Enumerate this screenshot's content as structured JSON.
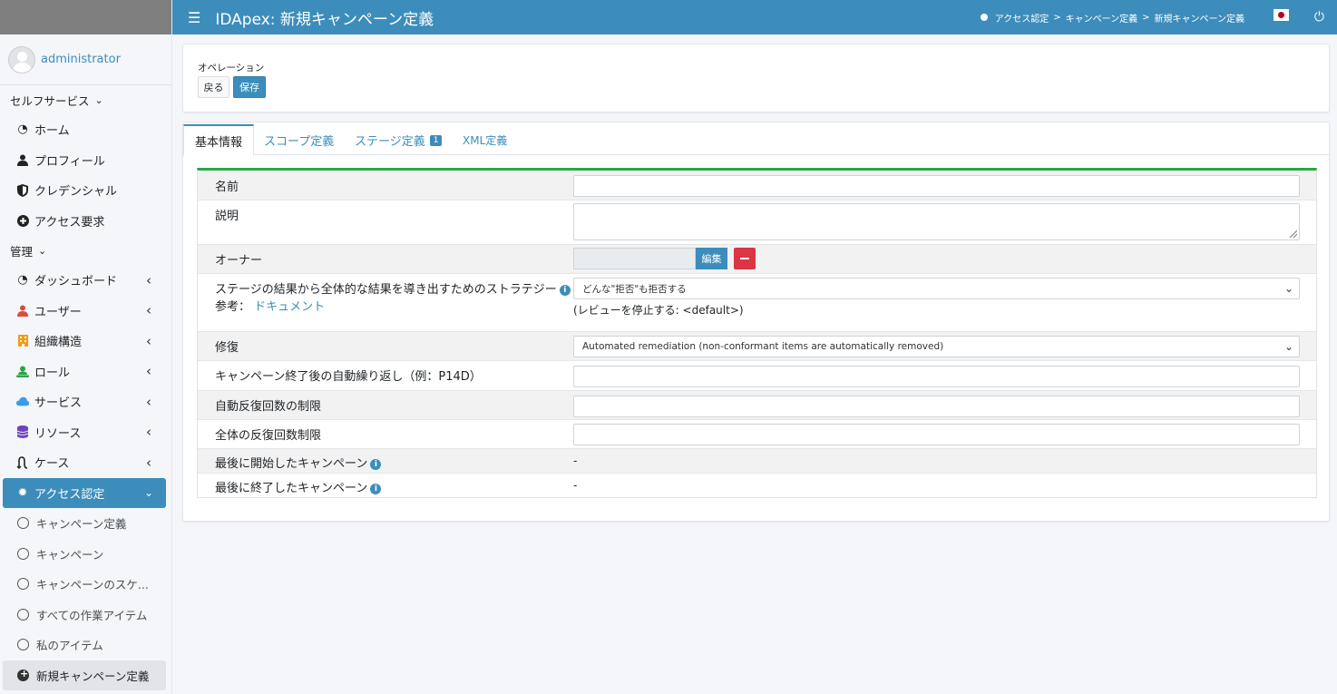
{
  "sidebar": {
    "user": "administrator",
    "self_service_header": "セルフサービス",
    "self_service": [
      {
        "icon": "dashboard-icon",
        "label": "ホーム"
      },
      {
        "icon": "user-icon",
        "label": "プロフィール"
      },
      {
        "icon": "shield-icon",
        "label": "クレデンシャル"
      },
      {
        "icon": "plus-circle-icon",
        "label": "アクセス要求"
      }
    ],
    "admin_header": "管理",
    "admin": [
      {
        "icon": "dashboard-icon",
        "label": "ダッシュボード"
      },
      {
        "icon": "user-icon",
        "label": "ユーザー",
        "color": "#dd4b39"
      },
      {
        "icon": "building-icon",
        "label": "組織構造",
        "color": "#f39c12"
      },
      {
        "icon": "role-icon",
        "label": "ロール",
        "color": "#28a745"
      },
      {
        "icon": "cloud-icon",
        "label": "サービス",
        "color": "#3c9be8"
      },
      {
        "icon": "database-icon",
        "label": "リソース",
        "color": "#6f42c1"
      },
      {
        "icon": "route-icon",
        "label": "ケース"
      }
    ],
    "active_item": "アクセス認定",
    "sub_items": [
      "キャンペーン定義",
      "キャンペーン",
      "キャンペーンのスケ...",
      "すべての作業アイテム",
      "私のアイテム",
      "新規キャンペーン定義"
    ]
  },
  "header": {
    "title": "IDApex: 新規キャンペーン定義",
    "breadcrumb": [
      "アクセス認定",
      "キャンペーン定義",
      "新規キャンペーン定義"
    ]
  },
  "operation": {
    "label": "オペレーション",
    "back": "戻る",
    "save": "保存"
  },
  "tabs": [
    {
      "label": "基本情報",
      "active": true
    },
    {
      "label": "スコープ定義"
    },
    {
      "label": "ステージ定義",
      "badge": "1"
    },
    {
      "label": "XML定義"
    }
  ],
  "form": {
    "name_label": "名前",
    "name_value": "",
    "description_label": "説明",
    "owner_label": "オーナー",
    "owner_edit": "編集",
    "strategy_label": "ステージの結果から全体的な結果を導き出すためのストラテジー",
    "strategy_ref_prefix": "参考：",
    "strategy_ref_link": "ドキュメント",
    "strategy_value": "どんな\"拒否\"も拒否する",
    "strategy_note": "(レビューを停止する: <default>)",
    "remediation_label": "修復",
    "remediation_value": "Automated remediation (non-conformant items are automatically removed)",
    "repeat_label": "キャンペーン終了後の自動繰り返し（例：P14D）",
    "repeat_limit_label": "自動反復回数の制限",
    "total_limit_label": "全体の反復回数制限",
    "last_started_label": "最後に開始したキャンペーン",
    "last_started_value": "-",
    "last_ended_label": "最後に終了したキャンペーン",
    "last_ended_value": "-"
  },
  "colors": {
    "primary": "#3c8dbc",
    "danger": "#dc3545",
    "success": "#28a745"
  }
}
